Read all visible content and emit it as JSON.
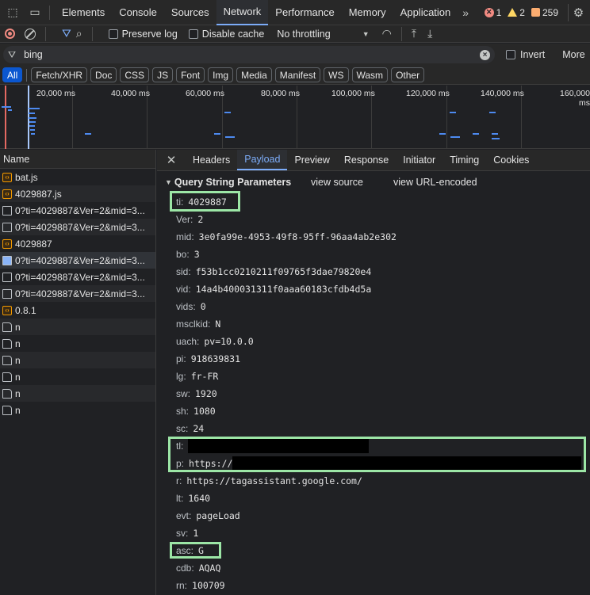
{
  "toolbar_tabs": [
    "Elements",
    "Console",
    "Sources",
    "Network",
    "Performance",
    "Memory",
    "Application"
  ],
  "active_tab": "Network",
  "counts": {
    "errors": "1",
    "warnings": "2",
    "issues": "259"
  },
  "network_toolbar": {
    "preserve_log": "Preserve log",
    "disable_cache": "Disable cache",
    "throttling": "No throttling"
  },
  "filter": {
    "value": "bing",
    "invert_label": "Invert",
    "more_label": "More"
  },
  "type_filters": [
    "All",
    "Fetch/XHR",
    "Doc",
    "CSS",
    "JS",
    "Font",
    "Img",
    "Media",
    "Manifest",
    "WS",
    "Wasm",
    "Other"
  ],
  "timeline_ticks": [
    "20,000 ms",
    "40,000 ms",
    "60,000 ms",
    "80,000 ms",
    "100,000 ms",
    "120,000 ms",
    "140,000 ms",
    "160,000 ms"
  ],
  "list": {
    "header": "Name",
    "rows": [
      {
        "name": "bat.js",
        "icon": "script-icon"
      },
      {
        "name": "4029887.js",
        "icon": "script-icon"
      },
      {
        "name": "0?ti=4029887&Ver=2&mid=3...",
        "icon": "document-icon"
      },
      {
        "name": "0?ti=4029887&Ver=2&mid=3...",
        "icon": "document-icon"
      },
      {
        "name": "4029887",
        "icon": "script-icon"
      },
      {
        "name": "0?ti=4029887&Ver=2&mid=3...",
        "icon": "image-icon"
      },
      {
        "name": "0?ti=4029887&Ver=2&mid=3...",
        "icon": "document-icon"
      },
      {
        "name": "0?ti=4029887&Ver=2&mid=3...",
        "icon": "document-icon"
      },
      {
        "name": "0.8.1",
        "icon": "script-icon"
      },
      {
        "name": "n",
        "icon": "file-icon"
      },
      {
        "name": "n",
        "icon": "file-icon"
      },
      {
        "name": "n",
        "icon": "file-icon"
      },
      {
        "name": "n",
        "icon": "file-icon"
      },
      {
        "name": "n",
        "icon": "file-icon"
      },
      {
        "name": "n",
        "icon": "file-icon"
      }
    ]
  },
  "detail_tabs": [
    "Headers",
    "Payload",
    "Preview",
    "Response",
    "Initiator",
    "Timing",
    "Cookies"
  ],
  "active_detail_tab": "Payload",
  "payload": {
    "section_title": "Query String Parameters",
    "view_source": "view source",
    "view_url_encoded": "view URL-encoded",
    "params": [
      {
        "key": "ti:",
        "value": "4029887"
      },
      {
        "key": "Ver:",
        "value": "2"
      },
      {
        "key": "mid:",
        "value": "3e0fa99e-4953-49f8-95ff-96aa4ab2e302"
      },
      {
        "key": "bo:",
        "value": "3"
      },
      {
        "key": "sid:",
        "value": "f53b1cc0210211f09765f3dae79820e4"
      },
      {
        "key": "vid:",
        "value": "14a4b400031311f0aaa60183cfdb4d5a"
      },
      {
        "key": "vids:",
        "value": "0"
      },
      {
        "key": "msclkid:",
        "value": "N"
      },
      {
        "key": "uach:",
        "value": "pv=10.0.0"
      },
      {
        "key": "pi:",
        "value": "918639831"
      },
      {
        "key": "lg:",
        "value": "fr-FR"
      },
      {
        "key": "sw:",
        "value": "1920"
      },
      {
        "key": "sh:",
        "value": "1080"
      },
      {
        "key": "sc:",
        "value": "24"
      },
      {
        "key": "tl:",
        "value": ""
      },
      {
        "key": "p:",
        "value": "https://"
      },
      {
        "key": "r:",
        "value": "https://tagassistant.google.com/"
      },
      {
        "key": "lt:",
        "value": "1640"
      },
      {
        "key": "evt:",
        "value": "pageLoad"
      },
      {
        "key": "sv:",
        "value": "1"
      },
      {
        "key": "asc:",
        "value": "G"
      },
      {
        "key": "cdb:",
        "value": "AQAQ"
      },
      {
        "key": "rn:",
        "value": "100709"
      }
    ]
  },
  "colors": {
    "highlight": "#9ce6a6",
    "accent": "#7cacf8",
    "redaction": "#000000"
  }
}
